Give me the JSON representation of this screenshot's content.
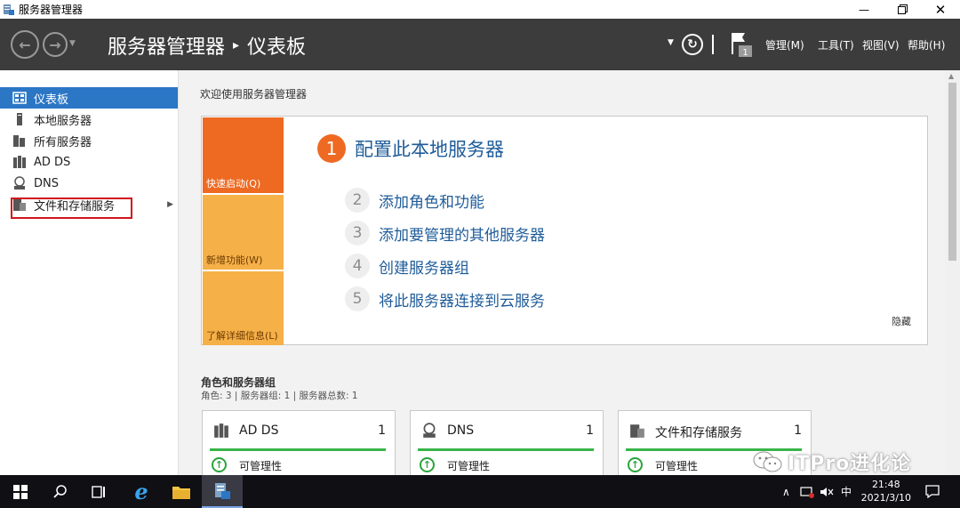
{
  "window": {
    "title": "服务器管理器",
    "minimize_icon": "minimize-icon",
    "restore_icon": "restore-icon",
    "close_icon": "close-icon"
  },
  "header": {
    "app_name": "服务器管理器",
    "separator": "▸",
    "page": "仪表板",
    "menu": [
      "管理(M)",
      "工具(T)",
      "视图(V)",
      "帮助(H)"
    ],
    "notification_count": "1"
  },
  "sidebar": {
    "items": [
      {
        "label": "仪表板",
        "icon": "dashboard-icon",
        "active": true
      },
      {
        "label": "本地服务器",
        "icon": "server-icon"
      },
      {
        "label": "所有服务器",
        "icon": "servers-icon"
      },
      {
        "label": "AD DS",
        "icon": "ad-ds-icon"
      },
      {
        "label": "DNS",
        "icon": "dns-icon"
      },
      {
        "label": "文件和存储服务",
        "icon": "file-storage-icon",
        "highlighted": true
      }
    ]
  },
  "welcome": {
    "title": "欢迎使用服务器管理器",
    "tiles": [
      "快速启动(Q)",
      "新增功能(W)",
      "了解详细信息(L)"
    ],
    "steps": [
      {
        "num": "1",
        "label": "配置此本地服务器"
      },
      {
        "num": "2",
        "label": "添加角色和功能"
      },
      {
        "num": "3",
        "label": "添加要管理的其他服务器"
      },
      {
        "num": "4",
        "label": "创建服务器组"
      },
      {
        "num": "5",
        "label": "将此服务器连接到云服务"
      }
    ],
    "hide": "隐藏"
  },
  "roles": {
    "title": "角色和服务器组",
    "summary": "角色: 3 | 服务器组: 1 | 服务器总数: 1",
    "cards": [
      {
        "name": "AD DS",
        "count": "1",
        "status": "可管理性"
      },
      {
        "name": "DNS",
        "count": "1",
        "status": "可管理性"
      },
      {
        "name": "文件和存储服务",
        "count": "1",
        "status": "可管理性"
      }
    ]
  },
  "taskbar": {
    "time": "21:48",
    "date": "2021/3/10",
    "ime": "中"
  },
  "watermark": "ITPro进化论",
  "colors": {
    "header_bg": "#3c3c3c",
    "accent_blue": "#2b76c5",
    "tile_orange": "#ee6a22",
    "tile_yellow": "#f6b048",
    "status_green": "#39b54a",
    "highlight_red": "#d0161c"
  }
}
